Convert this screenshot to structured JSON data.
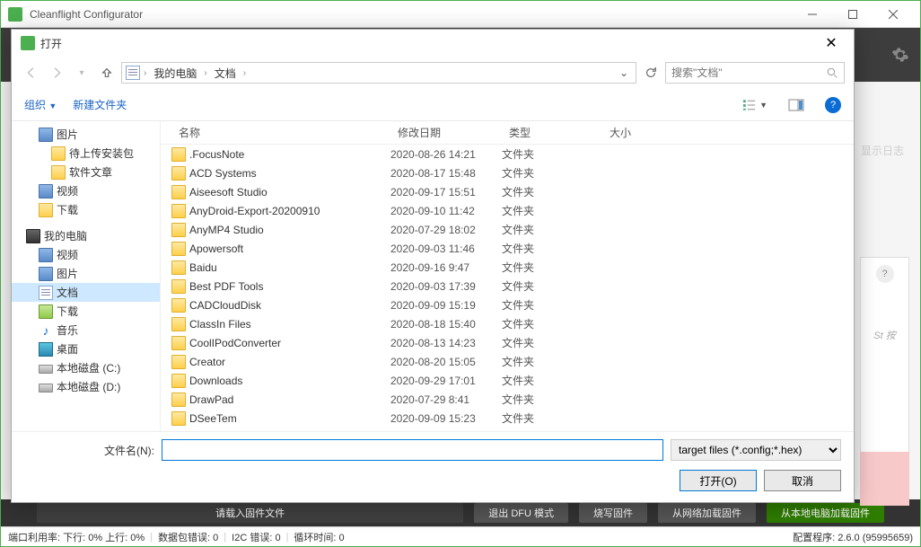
{
  "app": {
    "title": "Cleanflight Configurator",
    "showlog": "显示日志",
    "status": {
      "port": "端口利用率: 下行: 0% 上行: 0%",
      "pkterr": "数据包错误: 0",
      "i2cerr": "I2C 错误: 0",
      "cycle": "循环时间: 0",
      "cfgver": "配置程序: 2.6.0 (95995659)"
    },
    "sidepanel": {
      "st_text": "St 按"
    },
    "bottom_buttons": {
      "load": "请载入固件文件",
      "exitdfu": "退出 DFU 模式",
      "writefw": "烧写固件",
      "fromnet": "从网络加载固件",
      "fromlocal": "从本地电脑加载固件"
    }
  },
  "dialog": {
    "title": "打开",
    "breadcrumb": {
      "root": "我的电脑",
      "cur": "文档"
    },
    "search_ph": "搜索\"文档\"",
    "toolbar": {
      "org": "组织",
      "newf": "新建文件夹"
    },
    "tree": [
      {
        "label": "图片",
        "icon": "vfolder",
        "lvl": 1
      },
      {
        "label": "待上传安装包",
        "icon": "folder",
        "lvl": 2
      },
      {
        "label": "软件文章",
        "icon": "folder",
        "lvl": 2
      },
      {
        "label": "视频",
        "icon": "vfolder",
        "lvl": 1
      },
      {
        "label": "下载",
        "icon": "folder",
        "lvl": 1
      }
    ],
    "tree2": [
      {
        "label": "我的电脑",
        "icon": "pc",
        "lvl": 0
      },
      {
        "label": "视频",
        "icon": "vfolder",
        "lvl": 1
      },
      {
        "label": "图片",
        "icon": "vfolder",
        "lvl": 1
      },
      {
        "label": "文档",
        "icon": "doc",
        "lvl": 1,
        "sel": true
      },
      {
        "label": "下载",
        "icon": "dl",
        "lvl": 1
      },
      {
        "label": "音乐",
        "icon": "music",
        "lvl": 1
      },
      {
        "label": "桌面",
        "icon": "desk",
        "lvl": 1
      },
      {
        "label": "本地磁盘 (C:)",
        "icon": "drive",
        "lvl": 1
      },
      {
        "label": "本地磁盘 (D:)",
        "icon": "drive",
        "lvl": 1
      }
    ],
    "cols": {
      "name": "名称",
      "date": "修改日期",
      "type": "类型",
      "size": "大小"
    },
    "rows": [
      {
        "n": ".FocusNote",
        "d": "2020-08-26 14:21",
        "t": "文件夹"
      },
      {
        "n": "ACD Systems",
        "d": "2020-08-17 15:48",
        "t": "文件夹"
      },
      {
        "n": "Aiseesoft Studio",
        "d": "2020-09-17 15:51",
        "t": "文件夹"
      },
      {
        "n": "AnyDroid-Export-20200910",
        "d": "2020-09-10 11:42",
        "t": "文件夹"
      },
      {
        "n": "AnyMP4 Studio",
        "d": "2020-07-29 18:02",
        "t": "文件夹"
      },
      {
        "n": "Apowersoft",
        "d": "2020-09-03 11:46",
        "t": "文件夹"
      },
      {
        "n": "Baidu",
        "d": "2020-09-16 9:47",
        "t": "文件夹"
      },
      {
        "n": "Best PDF Tools",
        "d": "2020-09-03 17:39",
        "t": "文件夹"
      },
      {
        "n": "CADCloudDisk",
        "d": "2020-09-09 15:19",
        "t": "文件夹"
      },
      {
        "n": "ClassIn Files",
        "d": "2020-08-18 15:40",
        "t": "文件夹"
      },
      {
        "n": "CoolIPodConverter",
        "d": "2020-08-13 14:23",
        "t": "文件夹"
      },
      {
        "n": "Creator",
        "d": "2020-08-20 15:05",
        "t": "文件夹"
      },
      {
        "n": "Downloads",
        "d": "2020-09-29 17:01",
        "t": "文件夹"
      },
      {
        "n": "DrawPad",
        "d": "2020-07-29 8:41",
        "t": "文件夹"
      },
      {
        "n": "DSeeTem",
        "d": "2020-09-09 15:23",
        "t": "文件夹"
      }
    ],
    "fname_label": "文件名(N):",
    "filter": "target files (*.config;*.hex)",
    "open_btn": "打开(O)",
    "cancel_btn": "取消"
  }
}
